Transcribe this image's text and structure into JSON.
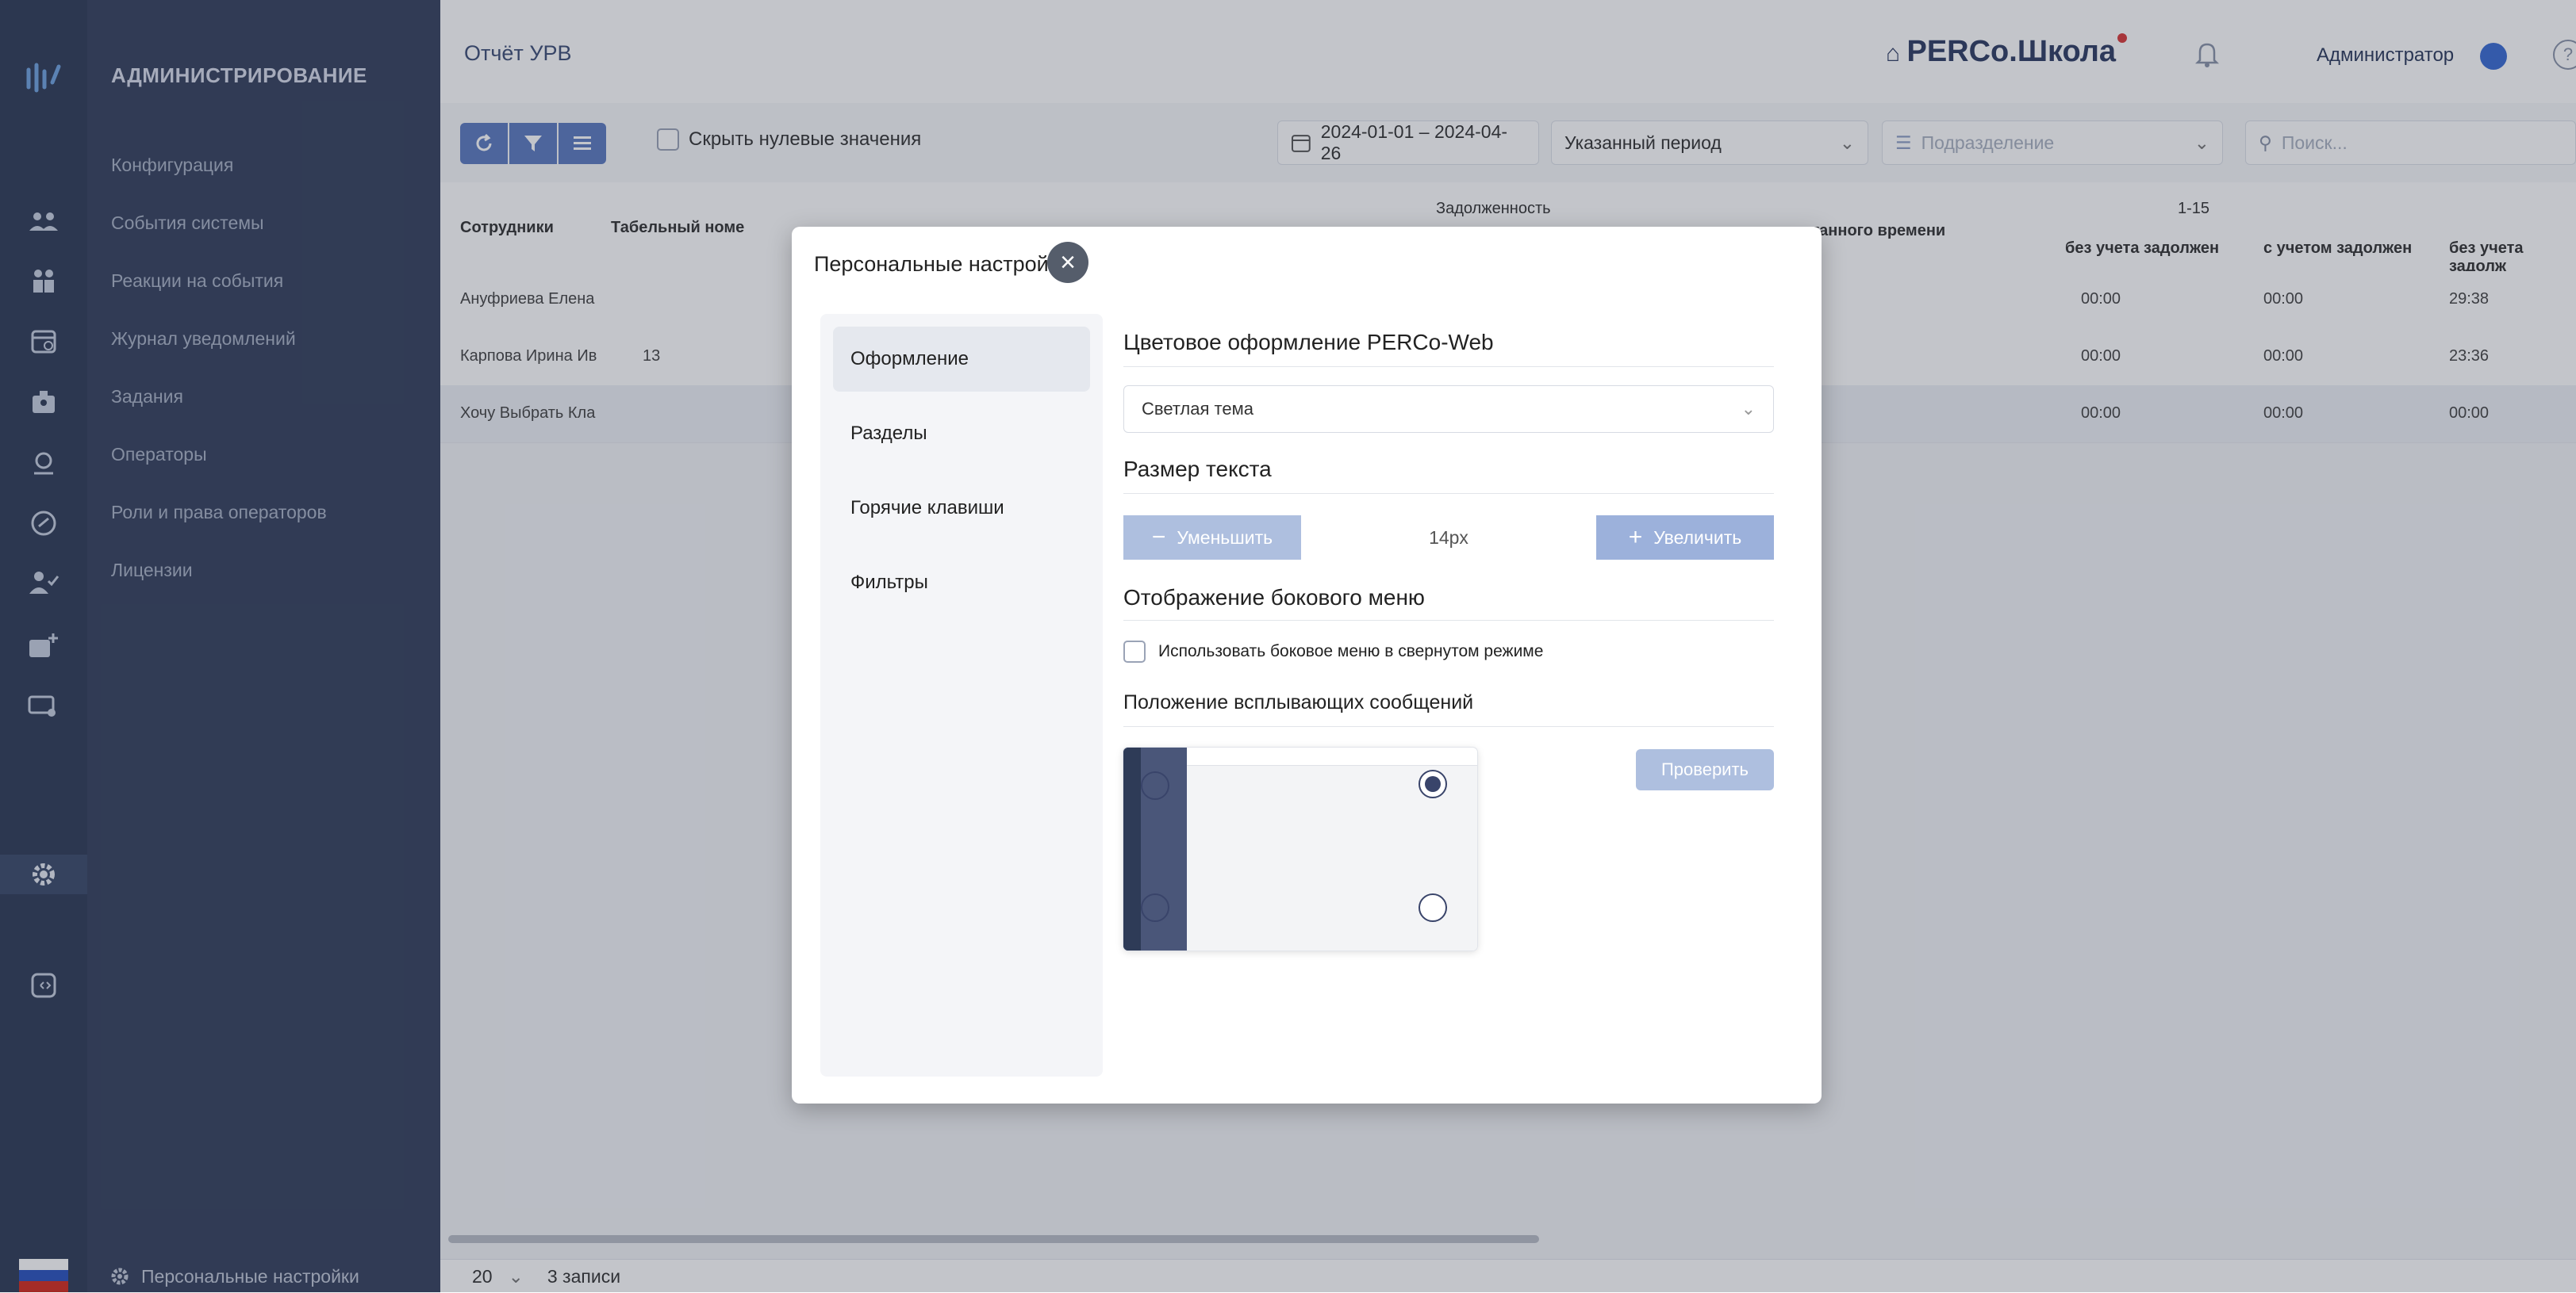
{
  "header": {
    "page_title": "Отчёт УРВ",
    "brand": "PERCo.Школа",
    "user": "Администратор",
    "help": "?"
  },
  "sidebar": {
    "heading": "АДМИНИСТРИРОВАНИЕ",
    "items": [
      "Конфигурация",
      "События системы",
      "Реакции на события",
      "Журнал уведомлений",
      "Задания",
      "Операторы",
      "Роли и права операторов",
      "Лицензии"
    ],
    "footer_label": "Персональные настройки"
  },
  "toolbar": {
    "hide_zero_label": "Скрыть нулевые значения",
    "date_range": "2024-01-01 – 2024-04-26",
    "period": "Указанный период",
    "department_placeholder": "Подразделение",
    "search_placeholder": "Поиск..."
  },
  "table": {
    "headers": {
      "employees": "Сотрудники",
      "tab_number": "Табельный номе",
      "debt": "Задолженность",
      "worked": "...отанного времени",
      "range": "1-15",
      "col_a": "без учета задолжен",
      "col_b": "с учетом задолжен",
      "col_c": "без учета задолж"
    },
    "rows": [
      {
        "name": "Ануфриева Елена",
        "tab": "",
        "a": "00:00",
        "b": "00:00",
        "c": "29:38"
      },
      {
        "name": "Карпова Ирина Ив",
        "tab": "13",
        "a": "00:00",
        "b": "00:00",
        "c": "23:36"
      },
      {
        "name": "Хочу Выбрать Кла",
        "tab": "",
        "a": "00:00",
        "b": "00:00",
        "c": "00:00"
      }
    ]
  },
  "pager": {
    "page_size": "20",
    "count": "3 записи"
  },
  "modal": {
    "title": "Персональные настройки",
    "nav": [
      "Оформление",
      "Разделы",
      "Горячие клавиши",
      "Фильтры"
    ],
    "theme_section": "Цветовое оформление PERCo-Web",
    "theme_value": "Светлая тема",
    "text_size_section": "Размер текста",
    "decrease": "Уменьшить",
    "text_size_value": "14px",
    "increase": "Увеличить",
    "side_menu_section": "Отображение бокового меню",
    "side_menu_checkbox": "Использовать боковое меню в свернутом режиме",
    "popup_position_section": "Положение всплывающих сообщений",
    "check_button": "Проверить"
  }
}
